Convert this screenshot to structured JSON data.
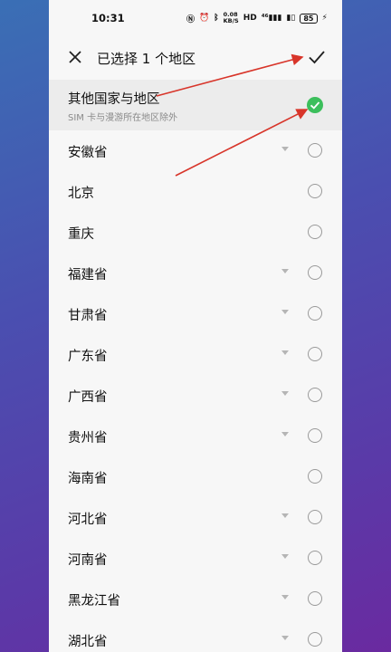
{
  "status_bar": {
    "time": "10:31",
    "net_speed_value": "0.08",
    "net_speed_unit": "KB/S",
    "network": "HD",
    "signal": "⁴⁶",
    "battery": "85"
  },
  "header": {
    "title": "已选择 1 个地区"
  },
  "regions": [
    {
      "label": "其他国家与地区",
      "sublabel": "SIM 卡与漫游所在地区除外",
      "selected": true,
      "expandable": false
    },
    {
      "label": "安徽省",
      "selected": false,
      "expandable": true
    },
    {
      "label": "北京",
      "selected": false,
      "expandable": false
    },
    {
      "label": "重庆",
      "selected": false,
      "expandable": false
    },
    {
      "label": "福建省",
      "selected": false,
      "expandable": true
    },
    {
      "label": "甘肃省",
      "selected": false,
      "expandable": true
    },
    {
      "label": "广东省",
      "selected": false,
      "expandable": true
    },
    {
      "label": "广西省",
      "selected": false,
      "expandable": true
    },
    {
      "label": "贵州省",
      "selected": false,
      "expandable": true
    },
    {
      "label": "海南省",
      "selected": false,
      "expandable": false
    },
    {
      "label": "河北省",
      "selected": false,
      "expandable": true
    },
    {
      "label": "河南省",
      "selected": false,
      "expandable": true
    },
    {
      "label": "黑龙江省",
      "selected": false,
      "expandable": true
    },
    {
      "label": "湖北省",
      "selected": false,
      "expandable": true
    }
  ],
  "colors": {
    "accent_green": "#3cbf5c",
    "annotation_red": "#d8352a"
  }
}
